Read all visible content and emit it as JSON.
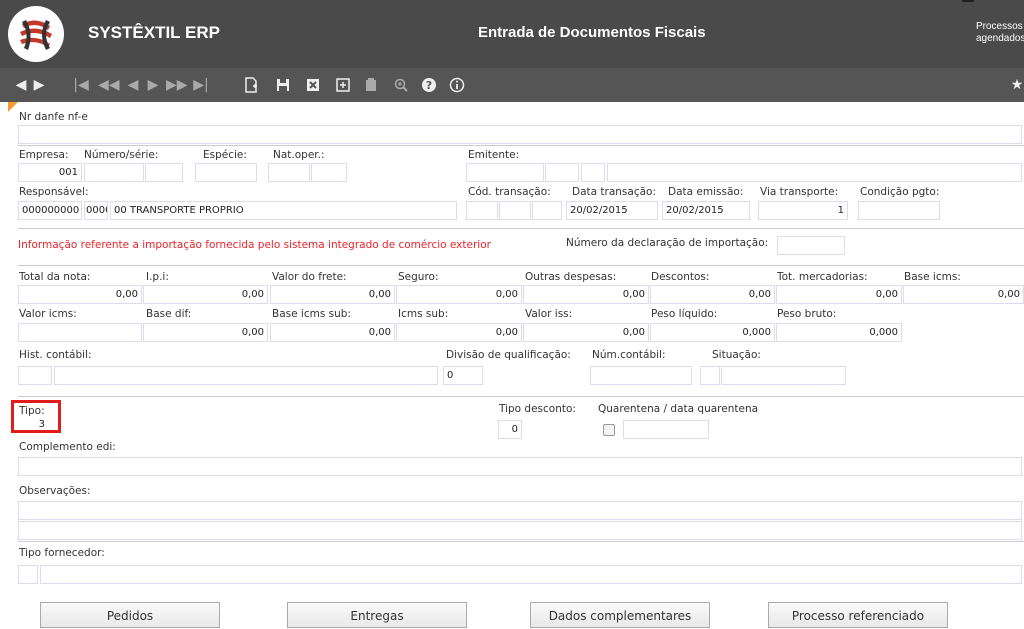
{
  "header": {
    "app_name": "SYSTÊXTIL ERP",
    "title": "Entrada de Documentos Fiscais",
    "processos": "Processos agendados"
  },
  "toolbar": {
    "icons": [
      "arrow-left-icon",
      "arrow-right-icon",
      "first-record-icon",
      "prev-page-icon",
      "prev-record-icon",
      "next-record-icon",
      "next-page-icon",
      "last-record-icon",
      "new-record-icon",
      "save-icon",
      "delete-icon",
      "add-detail-icon",
      "copy-icon",
      "zoom-icon",
      "help-icon",
      "info-icon",
      "star-icon"
    ]
  },
  "form": {
    "nr_danfe_label": "Nr danfe nf-e",
    "empresa_label": "Empresa:",
    "empresa_value": "001",
    "numero_serie_label": "Número/série:",
    "especie_label": "Espécie:",
    "nat_oper_label": "Nat.oper.:",
    "emitente_label": "Emitente:",
    "responsavel_label": "Responsável:",
    "resp_code": "000000000",
    "resp_seq": "0000",
    "resp_name": "00 TRANSPORTE PROPRIO",
    "cod_transacao_label": "Cód. transação:",
    "data_transacao_label": "Data transação:",
    "data_transacao_value": "20/02/2015",
    "data_emissao_label": "Data emissão:",
    "data_emissao_value": "20/02/2015",
    "via_transporte_label": "Via transporte:",
    "via_transporte_value": "1",
    "condicao_pgto_label": "Condição pgto:",
    "warning": "Informação referente a importação fornecida pelo sistema integrado de comércio exterior",
    "num_declaracao_label": "Número da declaração de importação:",
    "total_nota_label": "Total da nota:",
    "ipi_label": "I.p.i:",
    "valor_frete_label": "Valor do frete:",
    "seguro_label": "Seguro:",
    "outras_despesas_label": "Outras despesas:",
    "descontos_label": "Descontos:",
    "tot_mercadorias_label": "Tot. mercadorias:",
    "base_icms_label": "Base icms:",
    "row1_values": [
      "0,00",
      "0,00",
      "0,00",
      "0,00",
      "0,00",
      "0,00",
      "0,00",
      "0,00"
    ],
    "valor_icms_label": "Valor icms:",
    "base_dif_label": "Base dif:",
    "base_icms_sub_label": "Base icms sub:",
    "icms_sub_label": "Icms sub:",
    "valor_iss_label": "Valor iss:",
    "peso_liquido_label": "Peso líquido:",
    "peso_bruto_label": "Peso bruto:",
    "row2_values": [
      "0,00",
      "0,00",
      "0,00",
      "0,00",
      "0,000",
      "0,000"
    ],
    "hist_contabil_label": "Hist. contábil:",
    "divisao_label": "Divisão de qualificação:",
    "divisao_value": "0",
    "num_contabil_label": "Núm.contábil:",
    "situacao_label": "Situação:",
    "tipo_label": "Tipo:",
    "tipo_value": "3",
    "tipo_desconto_label": "Tipo desconto:",
    "tipo_desconto_value": "0",
    "quarentena_label": "Quarentena / data quarentena",
    "complemento_label": "Complemento edi:",
    "observacoes_label": "Observações:",
    "tipo_fornecedor_label": "Tipo fornecedor:"
  },
  "buttons": {
    "pedidos": "Pedidos",
    "entregas": "Entregas",
    "dados": "Dados complementares",
    "processo": "Processo referenciado"
  },
  "colors": {
    "header_bg": "#4a4a4a",
    "toolbar_bg": "#555555",
    "warning": "#e8232a",
    "highlight": "#e21b1b"
  }
}
